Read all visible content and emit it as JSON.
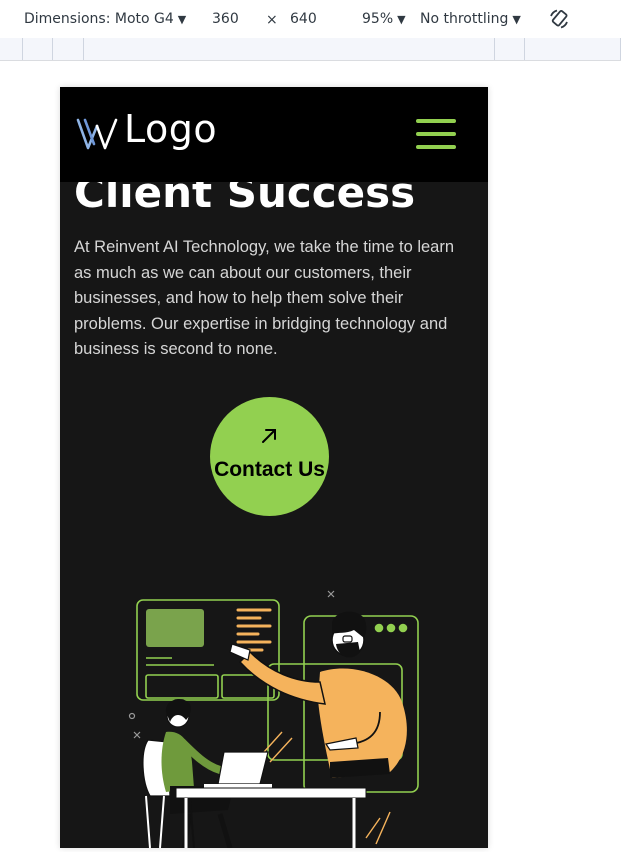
{
  "devtools": {
    "dimensions_label": "Dimensions: Moto G4",
    "width": "360",
    "times": "×",
    "height": "640",
    "zoom": "95%",
    "throttling": "No throttling",
    "caret": "▼"
  },
  "site": {
    "logo_text": "Logo",
    "heading": "Client Success",
    "intro": "At Reinvent AI Technology, we take the time to learn as much as we can about our customers, their businesses, and how to help them solve their problems. Our expertise in bridging technology and business is second to none.",
    "cta_label": "Contact Us",
    "cta_arrow": "↗"
  },
  "colors": {
    "accent": "#92d050",
    "page_bg": "#161616",
    "header_bg": "#000000",
    "person_shirt": "#f5b35c"
  }
}
